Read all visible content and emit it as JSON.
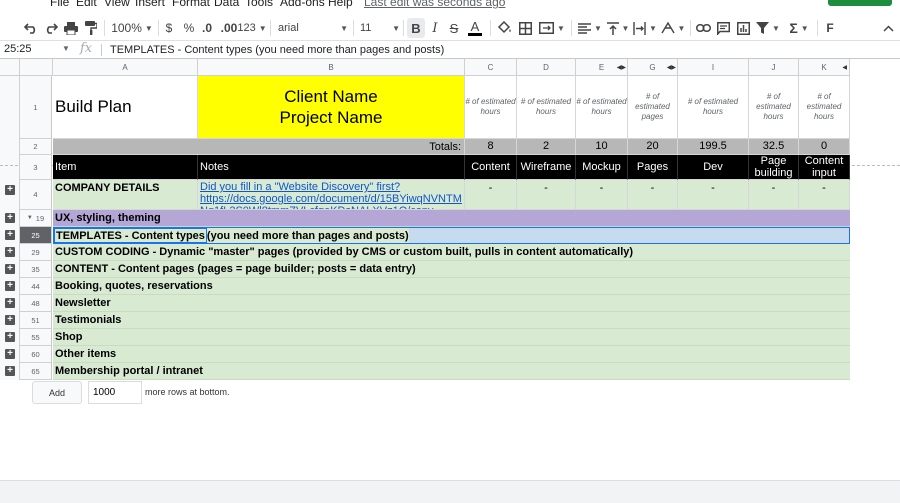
{
  "menu": {
    "items": [
      "File",
      "Edit",
      "View",
      "Insert",
      "Format",
      "Data",
      "Tools",
      "Add-ons",
      "Help"
    ],
    "last_edit": "Last edit was seconds ago"
  },
  "toolbar": {
    "zoom": "100%",
    "currency": "$",
    "percent": "%",
    "decrease_decimal": ".0",
    "increase_decimal": ".00",
    "more_formats": "123",
    "font": "arial",
    "font_size": "11",
    "bold": "B",
    "italic": "I",
    "strike": "S",
    "text_color": "A",
    "text_color_swatch": "#000000",
    "input_tools": "F"
  },
  "formula_bar": {
    "cell_ref": "25:25",
    "fx": "fx",
    "content": "TEMPLATES - Content types (you need more than pages and posts)"
  },
  "columns": [
    "A",
    "B",
    "C",
    "D",
    "E",
    "G",
    "I",
    "J",
    "K"
  ],
  "sheet": {
    "row1": {
      "num": "1",
      "title": "Build Plan",
      "client": "Client Name",
      "project": "Project Name",
      "est": [
        "# of estimated hours",
        "# of estimated hours",
        "# of estimated hours",
        "# of estimated pages",
        "# of estimated hours",
        "# of estimated hours",
        "# of estimated hours"
      ]
    },
    "row2": {
      "num": "2",
      "totals_label": "Totals:",
      "values": [
        "8",
        "2",
        "10",
        "20",
        "199.5",
        "32.5",
        "0"
      ]
    },
    "row3": {
      "num": "3",
      "item": "Item",
      "notes": "Notes",
      "cols": [
        "Content",
        "Wireframe",
        "Mockup",
        "Pages",
        "Dev",
        "Page building",
        "Content input"
      ]
    },
    "row4": {
      "num": "4",
      "label": "COMPANY DETAILS",
      "link_text": "Did you fill in a \"Website Discovery\" first?",
      "link_url": "https://docs.google.com/document/d/15BYiwqNVNTMNq1fL2S0Wl8tmmZVLcfgeKDsNALXVz1Q/copy",
      "dashes": [
        "-",
        "-",
        "-",
        "-",
        "-",
        "-",
        "-"
      ]
    },
    "rows": [
      {
        "num": "19",
        "label": "UX, styling, theming"
      },
      {
        "num": "25",
        "label": "TEMPLATES - Content types",
        "rest": " (you need more than pages and posts)"
      },
      {
        "num": "29",
        "label": "CUSTOM CODING - Dynamic \"master\" pages (provided by CMS or custom built, pulls in content automatically)"
      },
      {
        "num": "35",
        "label": "CONTENT - Content pages (pages = page builder; posts = data entry)"
      },
      {
        "num": "44",
        "label": "Booking, quotes, reservations"
      },
      {
        "num": "48",
        "label": "Newsletter"
      },
      {
        "num": "51",
        "label": "Testimonials"
      },
      {
        "num": "55",
        "label": "Shop"
      },
      {
        "num": "60",
        "label": "Other items"
      },
      {
        "num": "65",
        "label": "Membership portal / intranet"
      }
    ]
  },
  "add_rows": {
    "button": "Add",
    "value": "1000",
    "suffix": "more rows at bottom."
  },
  "colors": {
    "yellow": "#ffff00",
    "green": "#d9ead3",
    "purple": "#b4a7d6",
    "black": "#000000",
    "link": "#1155cc"
  }
}
